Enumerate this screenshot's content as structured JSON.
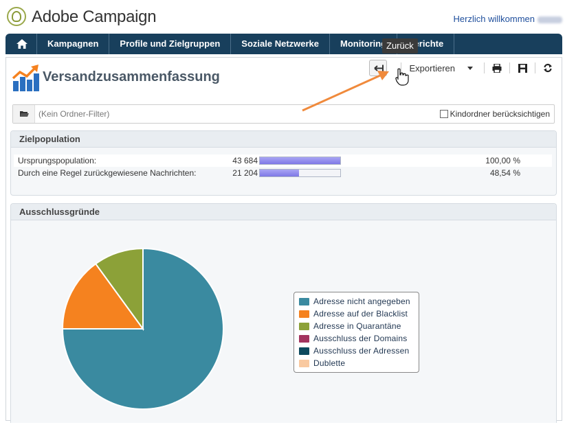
{
  "header": {
    "app_title": "Adobe Campaign",
    "welcome": "Herzlich willkommen"
  },
  "nav": {
    "items": [
      {
        "label": "Kampagnen"
      },
      {
        "label": "Profile und Zielgruppen"
      },
      {
        "label": "Soziale Netzwerke"
      },
      {
        "label": "Monitoring"
      },
      {
        "label": "Berichte"
      }
    ]
  },
  "tooltip": {
    "text": "Zurück"
  },
  "toolbar": {
    "export_label": "Exportieren"
  },
  "page": {
    "title": "Versandzusammenfassung"
  },
  "folder_filter": {
    "placeholder": "(Kein Ordner-Filter)",
    "include_children_label": "Kindordner berücksichtigen",
    "include_children_checked": false
  },
  "population": {
    "header": "Zielpopulation",
    "rows": [
      {
        "label": "Ursprungspopulation:",
        "count": "43 684",
        "fraction": 1.0,
        "percent": "100,00 %"
      },
      {
        "label": "Durch eine Regel zurückgewiesene Nachrichten:",
        "count": "21 204",
        "fraction": 0.4854,
        "percent": "48,54 %"
      }
    ]
  },
  "exclusions": {
    "header": "Ausschlussgründe"
  },
  "chart_data": {
    "type": "pie",
    "slices": [
      {
        "name": "Adresse nicht angegeben",
        "value": 75,
        "color": "#3a8aa0"
      },
      {
        "name": "Adresse auf der Blacklist",
        "value": 15,
        "color": "#f5821f"
      },
      {
        "name": "Adresse in Quarantäne",
        "value": 10,
        "color": "#8ca138"
      },
      {
        "name": "Ausschluss der Domains",
        "value": 0,
        "color": "#a3345e"
      },
      {
        "name": "Ausschluss der Adressen",
        "value": 0,
        "color": "#0d4a5e"
      },
      {
        "name": "Dublette",
        "value": 0,
        "color": "#f9c9a0"
      }
    ],
    "legend_position": "right"
  },
  "colors": {
    "nav_bg": "#183f5c",
    "annotation_arrow": "#f08a3c"
  }
}
